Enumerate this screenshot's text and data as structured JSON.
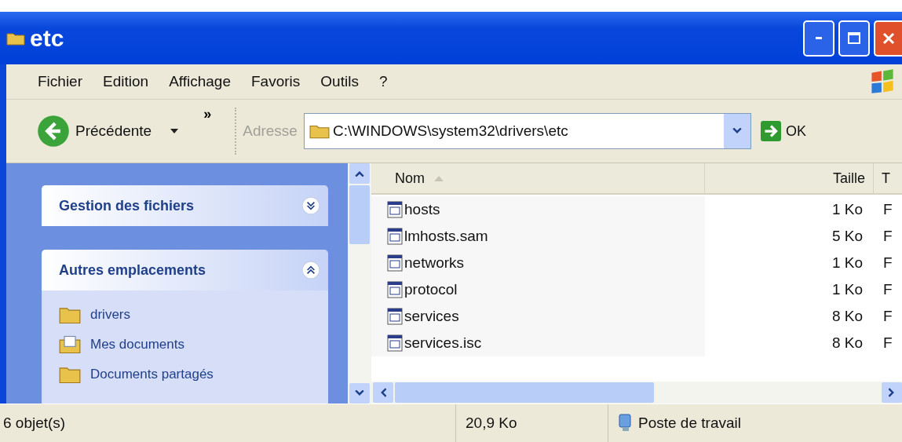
{
  "window": {
    "title": "etc"
  },
  "menu": [
    "Fichier",
    "Edition",
    "Affichage",
    "Favoris",
    "Outils",
    "?"
  ],
  "toolbar": {
    "back_label": "Précédente",
    "more": "»",
    "address_label": "Adresse",
    "address": "C:\\WINDOWS\\system32\\drivers\\etc",
    "go_label": "OK"
  },
  "sidebar": {
    "sections": [
      {
        "title": "Gestion des fichiers",
        "expanded": false
      },
      {
        "title": "Autres emplacements",
        "expanded": true,
        "items": [
          {
            "label": "drivers",
            "kind": "folder"
          },
          {
            "label": "Mes documents",
            "kind": "documents"
          },
          {
            "label": "Documents partagés",
            "kind": "folder"
          }
        ]
      }
    ]
  },
  "table": {
    "columns": [
      {
        "label": "Nom",
        "sorted": true
      },
      {
        "label": "Taille",
        "sorted": false
      },
      {
        "label": "T",
        "sorted": false
      }
    ],
    "rows": [
      {
        "name": "hosts",
        "size": "1 Ko",
        "column_3": "F"
      },
      {
        "name": "lmhosts.sam",
        "size": "5 Ko",
        "column_3": "F"
      },
      {
        "name": "networks",
        "size": "1 Ko",
        "column_3": "F"
      },
      {
        "name": "protocol",
        "size": "1 Ko",
        "column_3": "F"
      },
      {
        "name": "services",
        "size": "8 Ko",
        "column_3": "F"
      },
      {
        "name": "services.isc",
        "size": "8 Ko",
        "column_3": "F"
      }
    ]
  },
  "status_bar": [
    {
      "text": "6 objet(s)",
      "kind": "count"
    },
    {
      "text": "20,9 Ko",
      "kind": "size"
    },
    {
      "text": "Poste de travail",
      "kind": "computer"
    }
  ]
}
